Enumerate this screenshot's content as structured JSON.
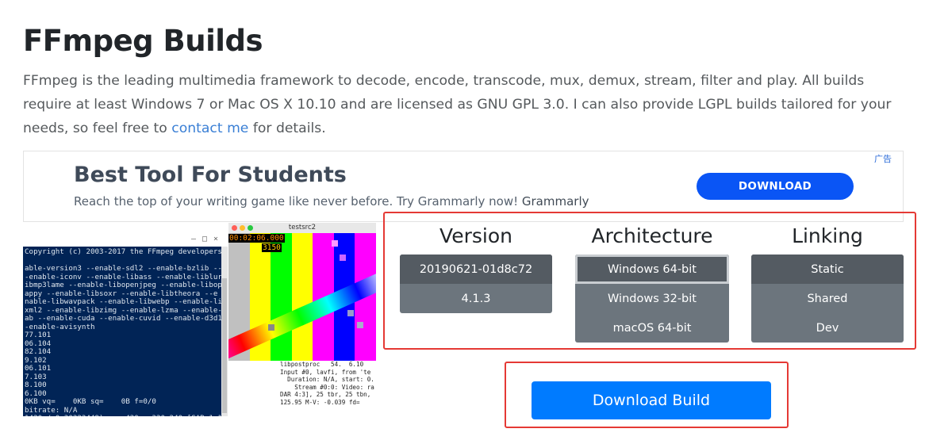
{
  "page": {
    "title": "FFmpeg Builds",
    "intro_text": "FFmpeg is the leading multimedia framework to decode, encode, transcode, mux, demux, stream, filter and play. All builds require at least Windows 7 or Mac OS X 10.10 and are licensed as GNU GPL 3.0. I can also provide LGPL builds tailored for your needs, so feel free to ",
    "contact_link": "contact me",
    "intro_suffix": " for details."
  },
  "ad": {
    "badge": "广告",
    "title": "Best Tool For Students",
    "description": "Reach the top of your writing game like never before. Try Grammarly now!",
    "brand": "Grammarly",
    "cta": "DOWNLOAD",
    "cta_color": "#0a55f5"
  },
  "terminal": {
    "lines": "Copyright (c) 2003-2017 the FFmpeg developers\n\nable-version3 --enable-sdl2 --enable-bzlib --e\n-enable-iconv --enable-libass --enable-liblur\nibmp3lame --enable-libopenjpeg --enable-libopu\nappy --enable-libsoxr --enable-libtheora --e\nnable-libwavpack --enable-libwebp --enable-lib\nxml2 --enable-libzimg --enable-lzma --enable-z\nab --enable-cuda --enable-cuvid --enable-d3d11\n-enable-avisynth\n77.101\n06.104\n82.104\n9.102\n06.101\n7.103\n8.100\n6.100\n0KB vq=    0KB sq=    0B f=0/0\nbitrate: N/A\n1420 / 0x30323449), yuv420p, 320x240 [SAR 1:1\n\n0KB vq= 2927KB sq=    0B f=0/0"
  },
  "testsrc": {
    "window_title": "testsrc2",
    "timecode": "00:02:06.000",
    "frame": "3150",
    "bar_colors": [
      "#c0c0c0",
      "#ffff00",
      "#00ff00",
      "#ffff00",
      "#ff00ff",
      "#0000ff",
      "#ff00ff"
    ],
    "log": "libpostproc   54.  6.10\nInput #0, lavfi, from 'te\n  Duration: N/A, start: 0.\n    Stream #0:0: Video: ra\nDAR 4:3], 25 tbr, 25 tbn,\n125.95 M-V: -0.039 fd="
  },
  "selector": {
    "version": {
      "heading": "Version",
      "options": [
        "20190621-01d8c72",
        "4.1.3"
      ],
      "selected": "20190621-01d8c72"
    },
    "architecture": {
      "heading": "Architecture",
      "options": [
        "Windows 64-bit",
        "Windows 32-bit",
        "macOS 64-bit"
      ],
      "selected": "Windows 64-bit"
    },
    "linking": {
      "heading": "Linking",
      "options": [
        "Static",
        "Shared",
        "Dev"
      ],
      "selected": "Static"
    }
  },
  "download": {
    "label": "Download Build",
    "color": "#007bff"
  },
  "colors": {
    "highlight_border": "#e53935",
    "option_bg": "#6c757d",
    "option_active_bg": "#545b62",
    "link": "#3a7fd5"
  }
}
